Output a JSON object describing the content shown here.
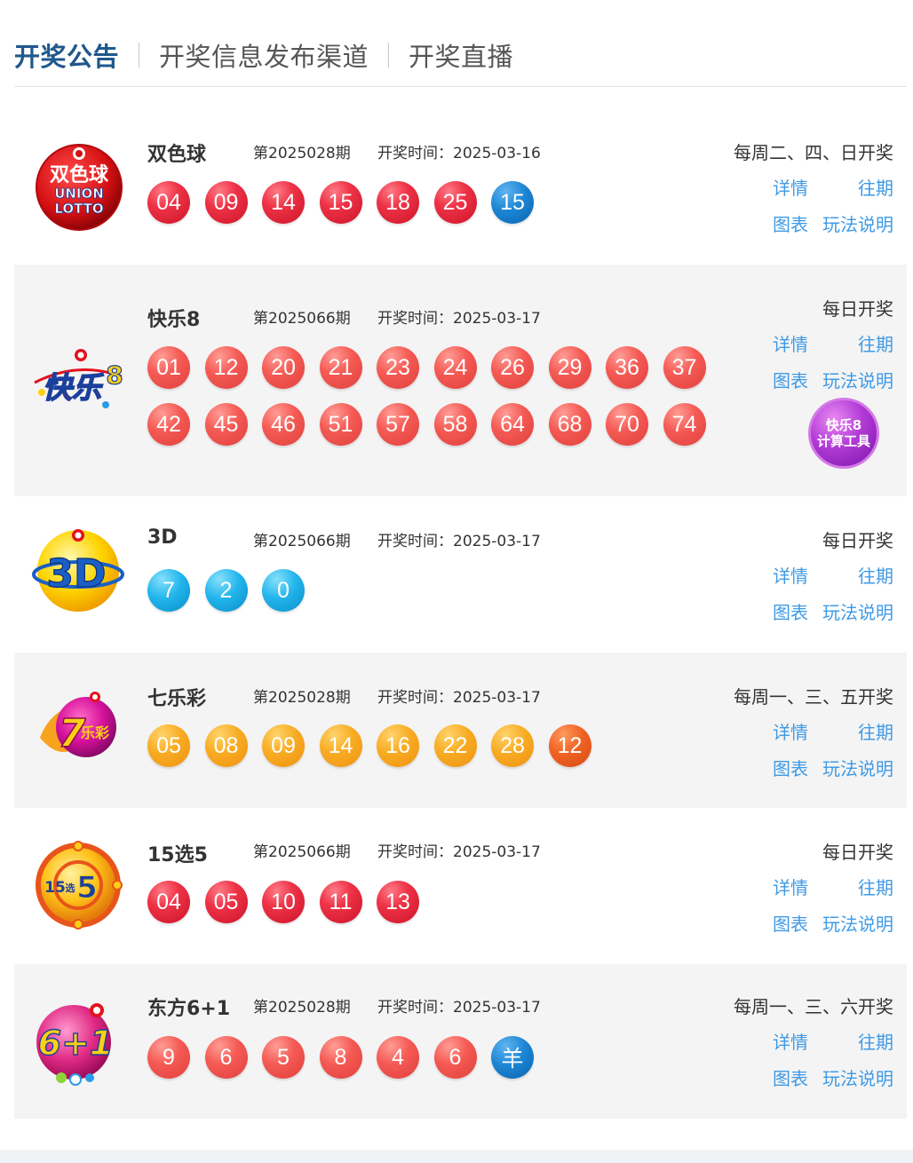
{
  "tabs": [
    "开奖公告",
    "开奖信息发布渠道",
    "开奖直播"
  ],
  "labels": {
    "detail": "详情",
    "history": "往期",
    "chart": "图表",
    "rules": "玩法说明"
  },
  "calc_tool": {
    "line1": "快乐8",
    "line2": "计算工具"
  },
  "lotteries": [
    {
      "name": "双色球",
      "issue": "第2025028期",
      "draw_time": "开奖时间：2025-03-16",
      "schedule": "每周二、四、日开奖",
      "logo": "union-lotto-logo",
      "balls": [
        {
          "v": "04",
          "c": "red"
        },
        {
          "v": "09",
          "c": "red"
        },
        {
          "v": "14",
          "c": "red"
        },
        {
          "v": "15",
          "c": "red"
        },
        {
          "v": "18",
          "c": "red"
        },
        {
          "v": "25",
          "c": "red"
        },
        {
          "v": "15",
          "c": "blue"
        }
      ]
    },
    {
      "name": "快乐8",
      "issue": "第2025066期",
      "draw_time": "开奖时间：2025-03-17",
      "schedule": "每日开奖",
      "logo": "kuaile8-logo",
      "balls": [
        {
          "v": "01",
          "c": "coral"
        },
        {
          "v": "12",
          "c": "coral"
        },
        {
          "v": "20",
          "c": "coral"
        },
        {
          "v": "21",
          "c": "coral"
        },
        {
          "v": "23",
          "c": "coral"
        },
        {
          "v": "24",
          "c": "coral"
        },
        {
          "v": "26",
          "c": "coral"
        },
        {
          "v": "29",
          "c": "coral"
        },
        {
          "v": "36",
          "c": "coral"
        },
        {
          "v": "37",
          "c": "coral"
        },
        {
          "v": "42",
          "c": "coral"
        },
        {
          "v": "45",
          "c": "coral"
        },
        {
          "v": "46",
          "c": "coral"
        },
        {
          "v": "51",
          "c": "coral"
        },
        {
          "v": "57",
          "c": "coral"
        },
        {
          "v": "58",
          "c": "coral"
        },
        {
          "v": "64",
          "c": "coral"
        },
        {
          "v": "68",
          "c": "coral"
        },
        {
          "v": "70",
          "c": "coral"
        },
        {
          "v": "74",
          "c": "coral"
        }
      ]
    },
    {
      "name": "3D",
      "issue": "第2025066期",
      "draw_time": "开奖时间：2025-03-17",
      "schedule": "每日开奖",
      "logo": "3d-logo",
      "balls": [
        {
          "v": "7",
          "c": "cyan"
        },
        {
          "v": "2",
          "c": "cyan"
        },
        {
          "v": "0",
          "c": "cyan"
        }
      ]
    },
    {
      "name": "七乐彩",
      "issue": "第2025028期",
      "draw_time": "开奖时间：2025-03-17",
      "schedule": "每周一、三、五开奖",
      "logo": "qilecai-logo",
      "balls": [
        {
          "v": "05",
          "c": "orange"
        },
        {
          "v": "08",
          "c": "orange"
        },
        {
          "v": "09",
          "c": "orange"
        },
        {
          "v": "14",
          "c": "orange"
        },
        {
          "v": "16",
          "c": "orange"
        },
        {
          "v": "22",
          "c": "orange"
        },
        {
          "v": "28",
          "c": "orange"
        },
        {
          "v": "12",
          "c": "dkorange"
        }
      ]
    },
    {
      "name": "15选5",
      "issue": "第2025066期",
      "draw_time": "开奖时间：2025-03-17",
      "schedule": "每日开奖",
      "logo": "15xuan5-logo",
      "balls": [
        {
          "v": "04",
          "c": "red"
        },
        {
          "v": "05",
          "c": "red"
        },
        {
          "v": "10",
          "c": "red"
        },
        {
          "v": "11",
          "c": "red"
        },
        {
          "v": "13",
          "c": "red"
        }
      ]
    },
    {
      "name": "东方6+1",
      "issue": "第2025028期",
      "draw_time": "开奖时间：2025-03-17",
      "schedule": "每周一、三、六开奖",
      "logo": "dongfang-6plus1-logo",
      "balls": [
        {
          "v": "9",
          "c": "coral"
        },
        {
          "v": "6",
          "c": "coral"
        },
        {
          "v": "5",
          "c": "coral"
        },
        {
          "v": "8",
          "c": "coral"
        },
        {
          "v": "4",
          "c": "coral"
        },
        {
          "v": "6",
          "c": "coral"
        },
        {
          "v": "羊",
          "c": "blue"
        }
      ]
    }
  ],
  "logo_text": {
    "ssq_main": "双色球",
    "ssq_union": "UNION",
    "ssq_lotto": "LOTTO",
    "kl8_main": "快乐",
    "kl8_num": "8",
    "d3_main": "3D",
    "qlc_num": "7",
    "qlc_text": "乐彩",
    "x15_num": "15",
    "x15_mid": "选",
    "x15_five": "5",
    "df_main": "6+1"
  },
  "colors": {
    "accent": "#20588c",
    "link": "#3f9ae6",
    "row_alt": "#f4f4f4"
  }
}
